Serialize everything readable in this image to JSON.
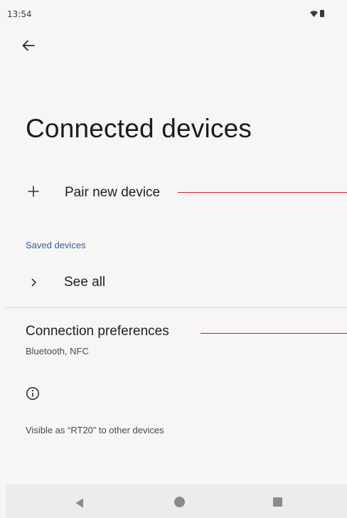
{
  "status_bar": {
    "time": "13:54",
    "icons": [
      "wifi-icon",
      "battery-icon"
    ]
  },
  "header": {
    "back_icon": "arrow-back-icon",
    "title": "Connected devices"
  },
  "pair_new_device": {
    "icon": "plus-icon",
    "label": "Pair new device"
  },
  "saved_devices": {
    "section_label": "Saved devices",
    "see_all": {
      "icon": "chevron-right-icon",
      "label": "See all"
    }
  },
  "connection_preferences": {
    "title": "Connection preferences",
    "subtitle": "Bluetooth, NFC"
  },
  "info": {
    "icon": "info-icon",
    "text": "Visible as “RT20” to other devices"
  },
  "nav_bar": {
    "back_icon": "nav-back-icon",
    "home_icon": "nav-home-icon",
    "recents_icon": "nav-recents-icon"
  },
  "colors": {
    "background": "#f7f6f5",
    "accent": "#3c5a9a",
    "annotation_line": "#cc1f1f"
  }
}
